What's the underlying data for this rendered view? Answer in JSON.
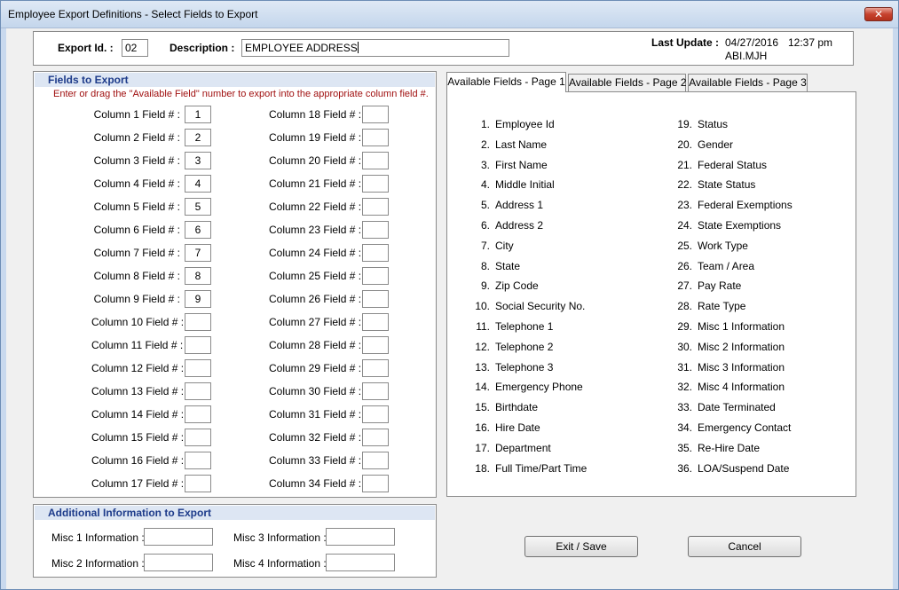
{
  "window": {
    "title": "Employee Export Definitions - Select Fields to Export",
    "close_glyph": "✕"
  },
  "header": {
    "export_id_label": "Export Id. :",
    "export_id_value": "02",
    "description_label": "Description :",
    "description_value": "EMPLOYEE ADDRESS",
    "last_update_label": "Last Update :",
    "last_update_date": "04/27/2016",
    "last_update_time": "12:37 pm",
    "last_update_user": "ABI.MJH"
  },
  "fields_to_export": {
    "title": "Fields to Export",
    "instruction": "Enter or drag the \"Available Field\" number to export into the appropriate column field #.",
    "columns_left": [
      {
        "label": "Column 1 Field # :",
        "value": "1"
      },
      {
        "label": "Column 2 Field # :",
        "value": "2"
      },
      {
        "label": "Column 3 Field # :",
        "value": "3"
      },
      {
        "label": "Column 4 Field # :",
        "value": "4"
      },
      {
        "label": "Column 5 Field # :",
        "value": "5"
      },
      {
        "label": "Column 6 Field # :",
        "value": "6"
      },
      {
        "label": "Column 7 Field # :",
        "value": "7"
      },
      {
        "label": "Column 8 Field # :",
        "value": "8"
      },
      {
        "label": "Column 9 Field # :",
        "value": "9"
      },
      {
        "label": "Column 10 Field # :",
        "value": ""
      },
      {
        "label": "Column 11 Field # :",
        "value": ""
      },
      {
        "label": "Column 12 Field # :",
        "value": ""
      },
      {
        "label": "Column 13 Field # :",
        "value": ""
      },
      {
        "label": "Column 14 Field # :",
        "value": ""
      },
      {
        "label": "Column 15 Field # :",
        "value": ""
      },
      {
        "label": "Column 16 Field # :",
        "value": ""
      },
      {
        "label": "Column 17 Field # :",
        "value": ""
      }
    ],
    "columns_right": [
      {
        "label": "Column 18 Field # :",
        "value": ""
      },
      {
        "label": "Column 19 Field # :",
        "value": ""
      },
      {
        "label": "Column 20 Field # :",
        "value": ""
      },
      {
        "label": "Column 21 Field # :",
        "value": ""
      },
      {
        "label": "Column 22 Field # :",
        "value": ""
      },
      {
        "label": "Column 23 Field # :",
        "value": ""
      },
      {
        "label": "Column 24 Field # :",
        "value": ""
      },
      {
        "label": "Column 25 Field # :",
        "value": ""
      },
      {
        "label": "Column 26 Field # :",
        "value": ""
      },
      {
        "label": "Column 27 Field # :",
        "value": ""
      },
      {
        "label": "Column 28 Field # :",
        "value": ""
      },
      {
        "label": "Column 29 Field # :",
        "value": ""
      },
      {
        "label": "Column 30 Field # :",
        "value": ""
      },
      {
        "label": "Column 31 Field # :",
        "value": ""
      },
      {
        "label": "Column 32 Field # :",
        "value": ""
      },
      {
        "label": "Column 33 Field # :",
        "value": ""
      },
      {
        "label": "Column 34 Field # :",
        "value": ""
      }
    ]
  },
  "additional_info": {
    "title": "Additional Information to Export",
    "misc1_label": "Misc 1 Information :",
    "misc1_value": "",
    "misc2_label": "Misc 2 Information :",
    "misc2_value": "",
    "misc3_label": "Misc 3 Information :",
    "misc3_value": "",
    "misc4_label": "Misc 4 Information :",
    "misc4_value": ""
  },
  "tabs": [
    {
      "label": "Available Fields - Page 1",
      "active": true
    },
    {
      "label": "Available Fields - Page 2",
      "active": false
    },
    {
      "label": "Available Fields - Page 3",
      "active": false
    }
  ],
  "available_fields_left": [
    {
      "num": "1.",
      "name": "Employee Id"
    },
    {
      "num": "2.",
      "name": "Last Name"
    },
    {
      "num": "3.",
      "name": "First Name"
    },
    {
      "num": "4.",
      "name": "Middle Initial"
    },
    {
      "num": "5.",
      "name": "Address 1"
    },
    {
      "num": "6.",
      "name": "Address 2"
    },
    {
      "num": "7.",
      "name": "City"
    },
    {
      "num": "8.",
      "name": "State"
    },
    {
      "num": "9.",
      "name": "Zip Code"
    },
    {
      "num": "10.",
      "name": "Social Security No."
    },
    {
      "num": "11.",
      "name": "Telephone 1"
    },
    {
      "num": "12.",
      "name": "Telephone 2"
    },
    {
      "num": "13.",
      "name": "Telephone 3"
    },
    {
      "num": "14.",
      "name": "Emergency Phone"
    },
    {
      "num": "15.",
      "name": "Birthdate"
    },
    {
      "num": "16.",
      "name": "Hire Date"
    },
    {
      "num": "17.",
      "name": "Department"
    },
    {
      "num": "18.",
      "name": "Full Time/Part Time"
    }
  ],
  "available_fields_right": [
    {
      "num": "19.",
      "name": "Status"
    },
    {
      "num": "20.",
      "name": "Gender"
    },
    {
      "num": "21.",
      "name": "Federal Status"
    },
    {
      "num": "22.",
      "name": "State Status"
    },
    {
      "num": "23.",
      "name": "Federal Exemptions"
    },
    {
      "num": "24.",
      "name": "State Exemptions"
    },
    {
      "num": "25.",
      "name": "Work Type"
    },
    {
      "num": "26.",
      "name": "Team / Area"
    },
    {
      "num": "27.",
      "name": "Pay Rate"
    },
    {
      "num": "28.",
      "name": "Rate Type"
    },
    {
      "num": "29.",
      "name": "Misc 1 Information"
    },
    {
      "num": "30.",
      "name": "Misc 2 Information"
    },
    {
      "num": "31.",
      "name": "Misc 3 Information"
    },
    {
      "num": "32.",
      "name": "Misc 4 Information"
    },
    {
      "num": "33.",
      "name": "Date Terminated"
    },
    {
      "num": "34.",
      "name": "Emergency Contact"
    },
    {
      "num": "35.",
      "name": "Re-Hire Date"
    },
    {
      "num": "36.",
      "name": "LOA/Suspend Date"
    }
  ],
  "buttons": {
    "exit_save": "Exit / Save",
    "cancel": "Cancel"
  }
}
